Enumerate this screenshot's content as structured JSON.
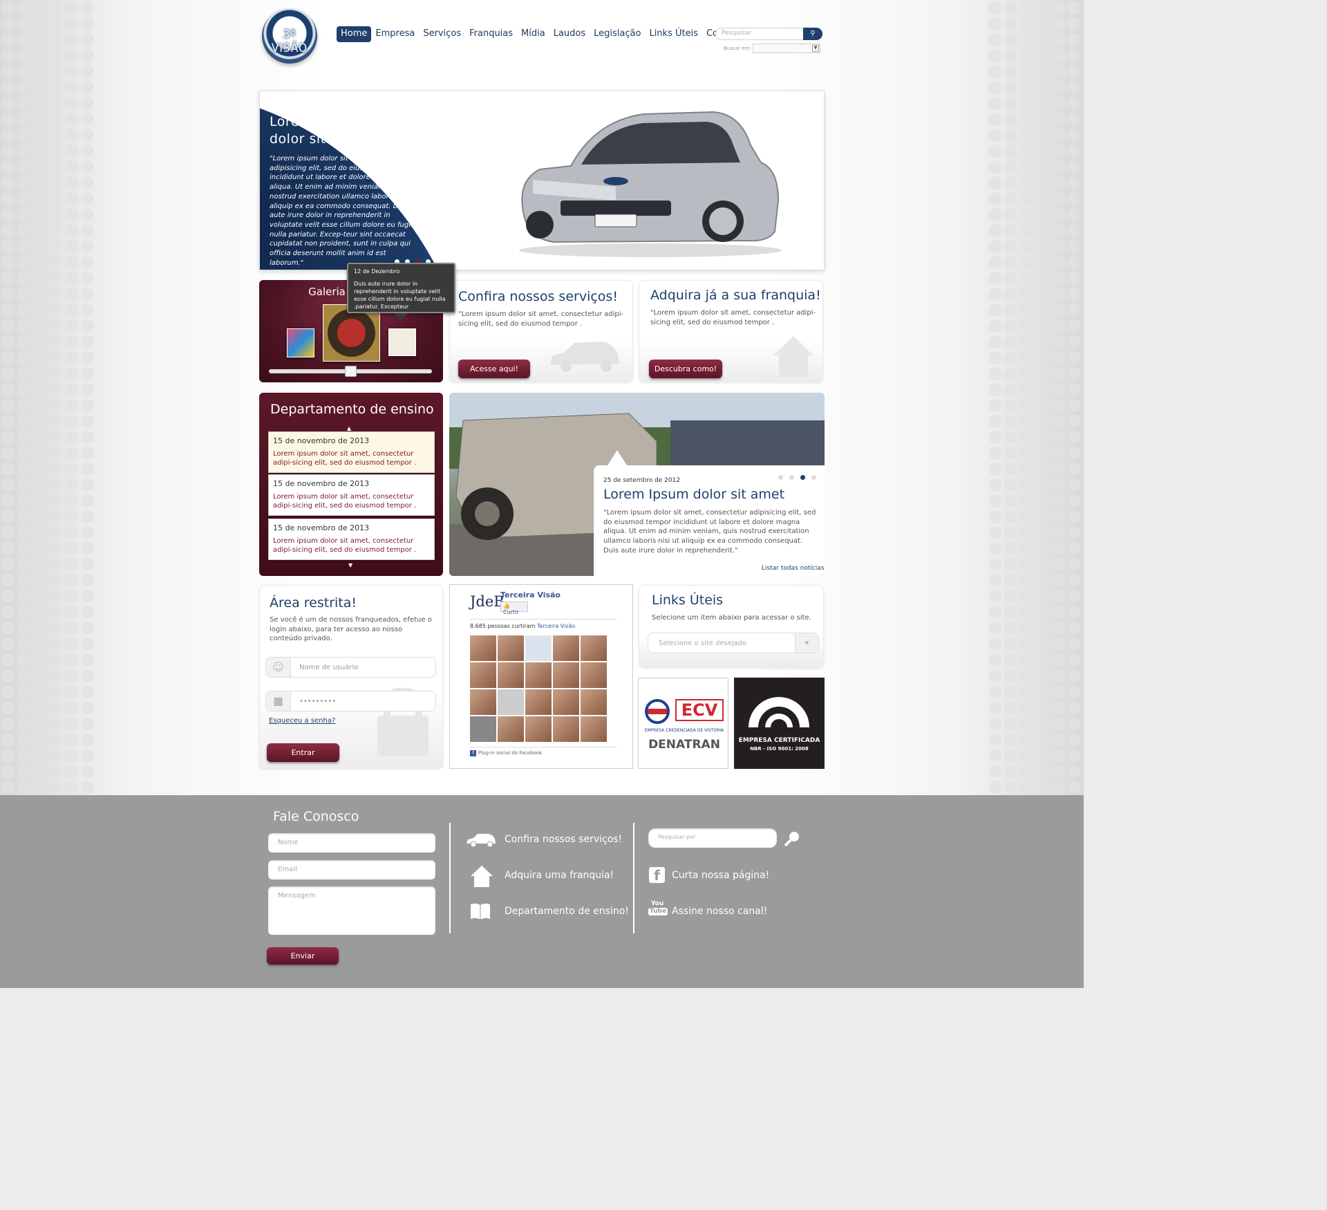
{
  "header": {
    "logo_text": "3ª VISÃO",
    "nav": [
      "Home",
      "Empresa",
      "Serviços",
      "Franquias",
      "Mídia",
      "Laudos",
      "Legislação",
      "Links Úteis",
      "Contato"
    ],
    "search_placeholder": "Pesquisar",
    "search_in_label": "Buscar em:"
  },
  "hero": {
    "title_line1": "Lorem  Ipsum",
    "title_line2": "dolor sit amet",
    "text": "\"Lorem ipsum dolor sit amet, consectetur adipisicing elit, sed do eiusmod tempor incididunt ut labore et dolore magna aliqua. Ut enim ad minim veniam, quis nostrud exercitation ullamco laboris nisi ut aliquip ex ea commodo consequat. Duis aute irure dolor in reprehenderit in voluptate velit esse cillum dolore eu fugiat nulla pariatur. Excep-teur sint occaecat cupidatat non proident, sunt in culpa qui officia deserunt mollit anim id est laborum.\""
  },
  "tooltip": {
    "date": "12 de Dezembro",
    "text": "Duis aute irure dolor in reprehenderit in voluptate velit esse cillum dolore eu fugiat nulla .pariatur. Excepteur"
  },
  "galeria": {
    "title": "Galeria",
    "slider_position": 0.5
  },
  "servicos": {
    "title": "Confira nossos serviços!",
    "text": "\"Lorem ipsum dolor sit amet, consectetur adipi-sicing elit, sed do eiusmod tempor .",
    "button": "Acesse aqui!"
  },
  "franquia": {
    "title": "Adquira já a sua franquia!",
    "text": "\"Lorem ipsum dolor sit amet, consectetur adipi-sicing elit, sed do eiusmod tempor .",
    "button": "Descubra como!"
  },
  "departamento": {
    "title": "Departamento de ensino",
    "items": [
      {
        "date": "15 de novembro de 2013",
        "text": "Lorem ipsum dolor sit amet, consectetur adipi-sicing elit, sed do eiusmod tempor ."
      },
      {
        "date": "15 de novembro de 2013",
        "text": "Lorem ipsum dolor sit amet, consectetur adipi-sicing elit, sed do eiusmod tempor ."
      },
      {
        "date": "15 de novembro de 2013",
        "text": "Lorem ipsum dolor sit amet, consectetur adipi-sicing elit, sed do eiusmod tempor ."
      }
    ]
  },
  "news": {
    "date": "25 de setembro de 2012",
    "title": "Lorem  Ipsum dolor sit amet",
    "text": "\"Lorem ipsum dolor sit amet, consectetur adipisicing elit, sed do eiusmod tempor incididunt ut labore et dolore magna aliqua. Ut enim ad minim veniam, quis nostrud exercitation ullamco laboris nisi ut aliquip ex ea commodo consequat. Duis aute irure dolor in reprehenderit.\"",
    "link": "Listar todas notícias"
  },
  "area_restrita": {
    "title": "Área restrita!",
    "text": "Se você é um de nossos franqueados, efetue o login abaixo, para ter acesso ao nosso conteúdo privado.",
    "user_placeholder": "Nome de usuário",
    "password_value": "•••••••••",
    "forgot": "Esqueceu a senha?",
    "button": "Entrar"
  },
  "facebook": {
    "page_name": "Terceira Visão",
    "logo_text": "JdeB",
    "like_button": "Curtir",
    "likes_text": "8.685 pessoas curtiram",
    "likes_page": "Terceira Visão",
    "plugin_text": "Plug-in social do Facebook"
  },
  "links_uteis": {
    "title": "Links Úteis",
    "text": "Selecione um item abaixo para acessar o site.",
    "select_placeholder": "Selecione o site desejado"
  },
  "ecv": {
    "big": "ECV",
    "sub": "EMPRESA CREDENCIADA DE VISTORIA",
    "name": "DENATRAN"
  },
  "iso": {
    "line1": "EMPRESA CERTIFICADA",
    "line2": "NBR - ISO 9001: 2008"
  },
  "footer": {
    "title": "Fale Conosco",
    "name_placeholder": "Nome",
    "email_placeholder": "Email",
    "message_placeholder": "Mensagem",
    "send_button": "Enviar",
    "links_mid": [
      "Confira nossos serviços!",
      "Adquira uma franquia!",
      "Departamento de ensino!"
    ],
    "search_placeholder": "Pesquisar por",
    "links_right": [
      "Curta nossa página!",
      "Assine nosso canal!"
    ]
  }
}
